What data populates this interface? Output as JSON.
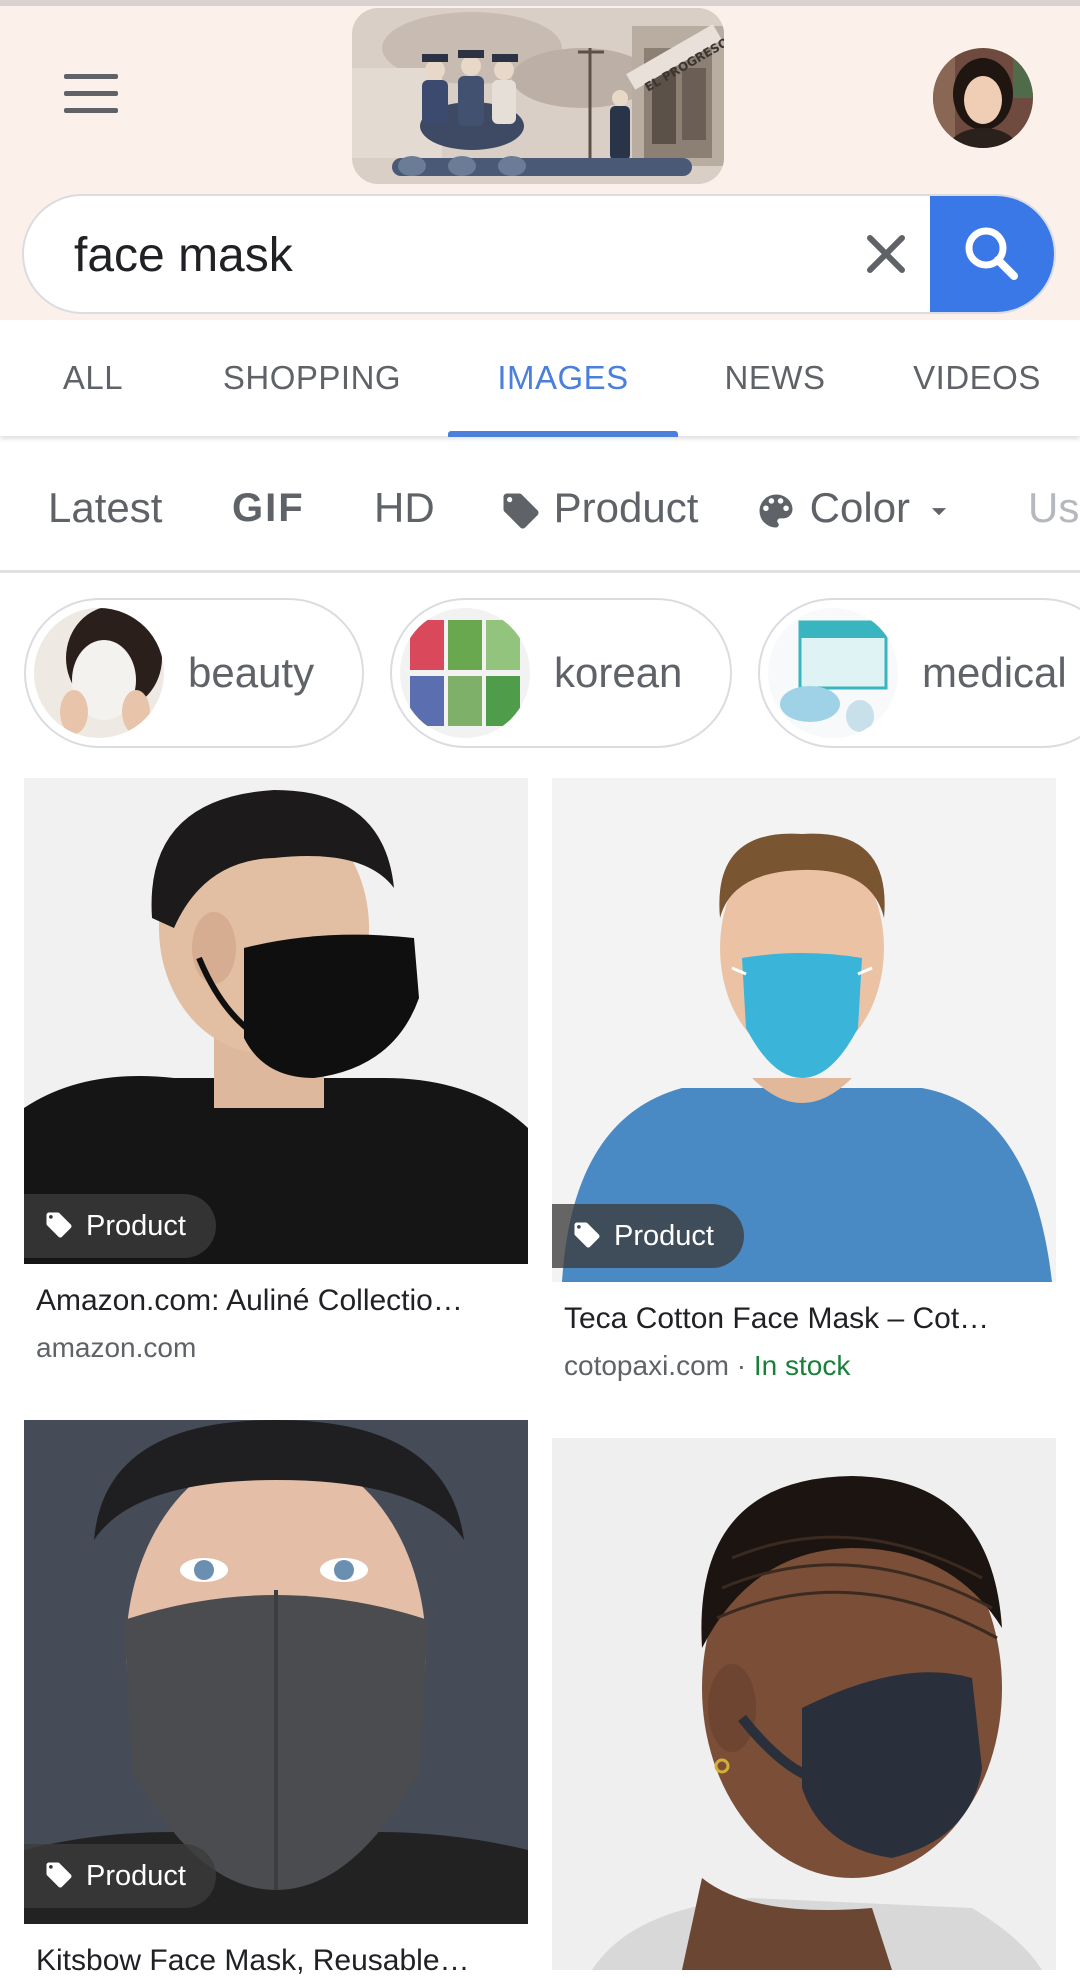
{
  "header": {
    "menu_icon": "hamburger-menu-icon",
    "doodle_text": "EL PROGRESO",
    "avatar": "profile-avatar"
  },
  "search": {
    "query": "face mask",
    "clear_icon": "close-icon",
    "search_icon": "search-icon"
  },
  "tabs": [
    {
      "label": "ALL",
      "active": false
    },
    {
      "label": "SHOPPING",
      "active": false
    },
    {
      "label": "IMAGES",
      "active": true
    },
    {
      "label": "NEWS",
      "active": false
    },
    {
      "label": "VIDEOS",
      "active": false
    }
  ],
  "filters": {
    "latest": "Latest",
    "gif": "GIF",
    "hd": "HD",
    "product": "Product",
    "color": "Color",
    "usage": "Us"
  },
  "chips": [
    {
      "label": "beauty"
    },
    {
      "label": "korean"
    },
    {
      "label": "medical"
    }
  ],
  "results": [
    {
      "badge": "Product",
      "title": "Amazon.com: Auliné Collectio…",
      "source": "amazon.com",
      "stock": ""
    },
    {
      "badge": "Product",
      "title": "Teca Cotton Face Mask – Cot…",
      "source": "cotopaxi.com · ",
      "stock": "In stock"
    },
    {
      "badge": "Product",
      "title": "Kitsbow Face Mask, Reusable…",
      "source": "",
      "stock": ""
    },
    {
      "badge": "",
      "title": "",
      "source": "",
      "stock": ""
    }
  ],
  "colors": {
    "accent": "#4a7fdb",
    "search_button": "#3b78e7",
    "in_stock": "#188038",
    "header_bg": "#fcf1ea"
  }
}
